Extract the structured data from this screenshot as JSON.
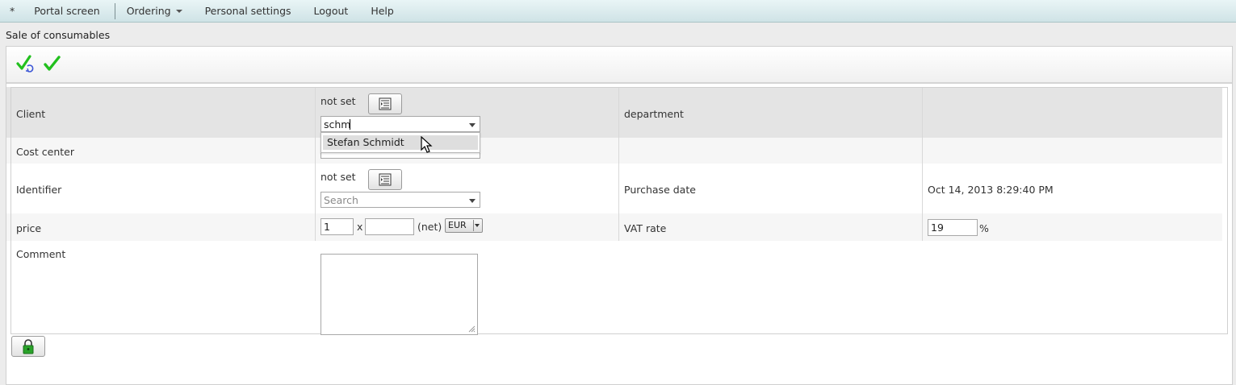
{
  "menu": {
    "star": "*",
    "portal": "Portal screen",
    "ordering": "Ordering",
    "personal": "Personal settings",
    "logout": "Logout",
    "help": "Help"
  },
  "page": {
    "title": "Sale of consumables"
  },
  "toolbar": {
    "icons": [
      "check-refresh-icon",
      "check-icon"
    ]
  },
  "form": {
    "client": {
      "label": "Client",
      "value": "not set",
      "search_text": "schm",
      "suggestion": "Stefan Schmidt"
    },
    "department": {
      "label": "department"
    },
    "cost_center": {
      "label": "Cost center"
    },
    "identifier": {
      "label": "Identifier",
      "value": "not set",
      "placeholder": "Search"
    },
    "purchase_date": {
      "label": "Purchase date",
      "value": "Oct 14, 2013 8:29:40 PM"
    },
    "price": {
      "label": "price",
      "quantity": "1",
      "times": "x",
      "net_value": "",
      "net_label": "(net)",
      "currency": "EUR"
    },
    "vat": {
      "label": "VAT rate",
      "value": "19",
      "unit": "%"
    },
    "comment": {
      "label": "Comment",
      "value": ""
    }
  },
  "colors": {
    "menubar": "#d6e9ec",
    "check": "#22c01e",
    "lock": "#2aa32a"
  }
}
